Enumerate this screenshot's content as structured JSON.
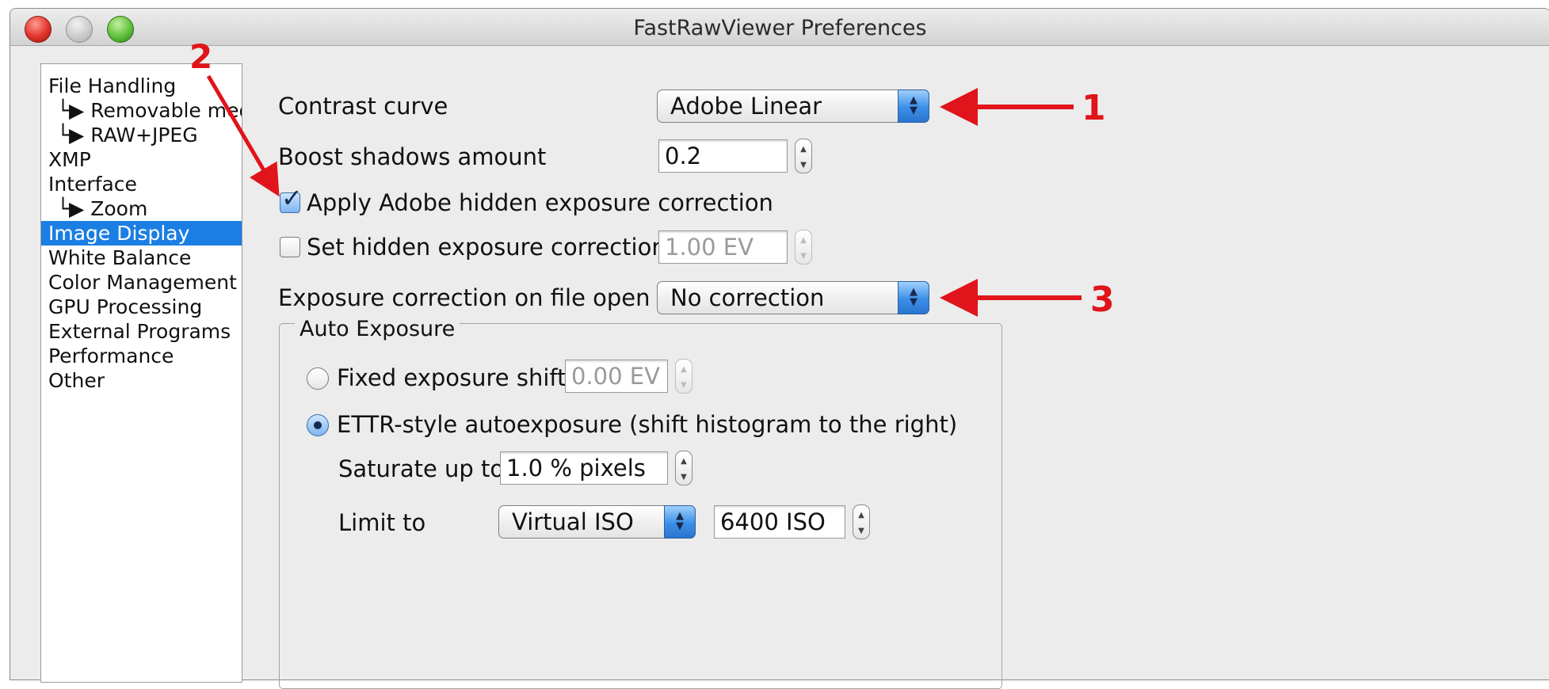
{
  "window": {
    "title": "FastRawViewer Preferences"
  },
  "sidebar": {
    "items": [
      {
        "label": "File Handling",
        "selected": false
      },
      {
        "label": "└▶ Removable media",
        "selected": false
      },
      {
        "label": "└▶ RAW+JPEG",
        "selected": false
      },
      {
        "label": "XMP",
        "selected": false
      },
      {
        "label": "Interface",
        "selected": false
      },
      {
        "label": "└▶ Zoom",
        "selected": false
      },
      {
        "label": "Image Display",
        "selected": true
      },
      {
        "label": "White Balance",
        "selected": false
      },
      {
        "label": "Color Management",
        "selected": false
      },
      {
        "label": "GPU Processing",
        "selected": false
      },
      {
        "label": "External Programs",
        "selected": false
      },
      {
        "label": "Performance",
        "selected": false
      },
      {
        "label": "Other",
        "selected": false
      }
    ]
  },
  "settings": {
    "contrast_curve": {
      "label": "Contrast curve",
      "value": "Adobe Linear"
    },
    "boost_shadows": {
      "label": "Boost shadows amount",
      "value": "0.2"
    },
    "apply_hidden": {
      "label": "Apply Adobe hidden exposure correction",
      "checked": true
    },
    "set_hidden": {
      "label": "Set hidden exposure correction to",
      "checked": false,
      "value": "1.00 EV"
    },
    "exposure_on_open": {
      "label": "Exposure correction on file open",
      "value": "No correction"
    }
  },
  "auto_exposure": {
    "title": "Auto Exposure",
    "fixed": {
      "label": "Fixed exposure shift",
      "selected": false,
      "value": "0.00 EV"
    },
    "ettr": {
      "label": "ETTR-style autoexposure (shift histogram to the right)",
      "selected": true
    },
    "saturate": {
      "label": "Saturate up to",
      "value": "1.0 % pixels"
    },
    "limit": {
      "label": "Limit to",
      "value": "Virtual ISO",
      "iso": "6400 ISO"
    }
  },
  "annotations": {
    "color": "#e0141a",
    "callouts": [
      "1",
      "2",
      "3"
    ]
  }
}
